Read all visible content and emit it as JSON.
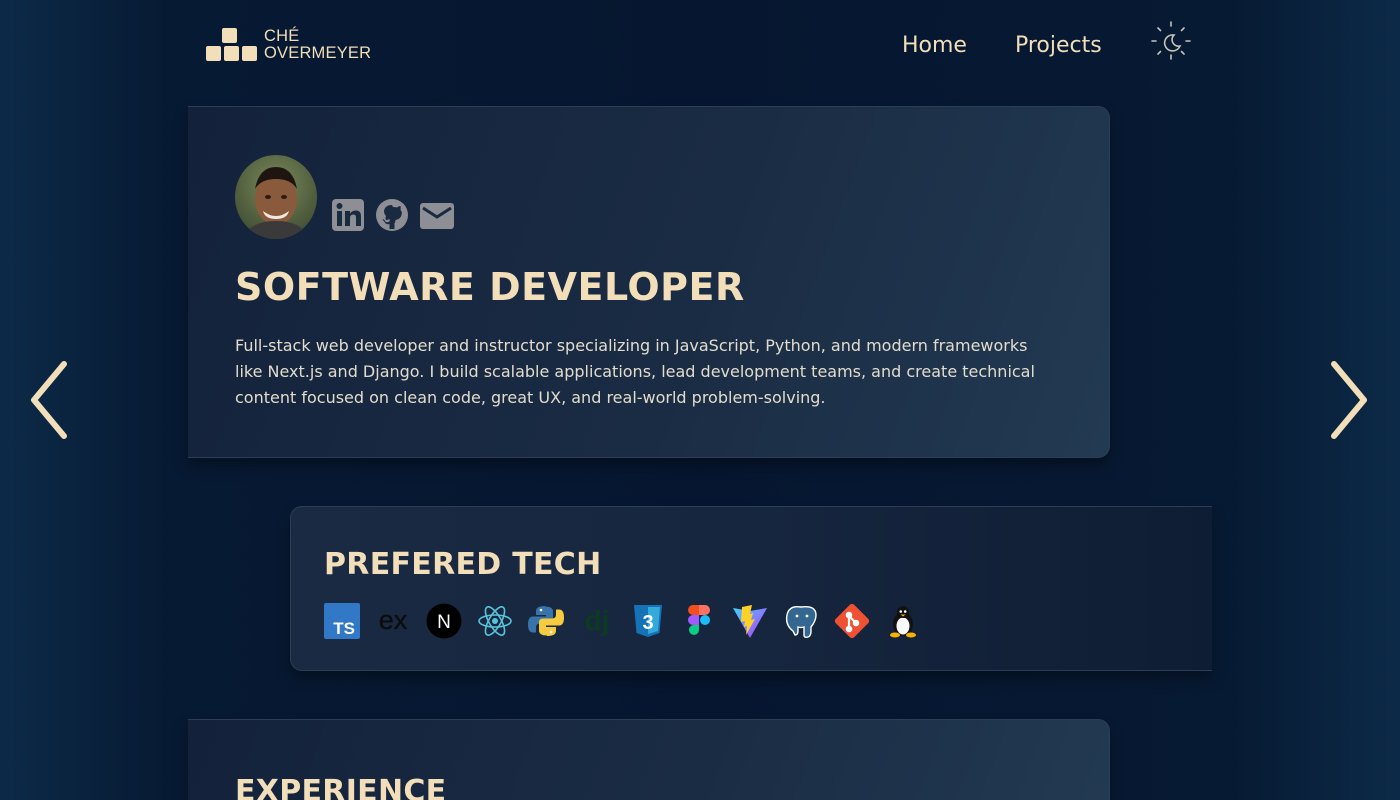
{
  "brand": {
    "line1": "CHÉ",
    "line2": "OVERMEYER"
  },
  "nav": {
    "home": "Home",
    "projects": "Projects"
  },
  "about": {
    "title": "SOFTWARE DEVELOPER",
    "bio": "Full-stack web developer and instructor specializing in JavaScript, Python, and modern frameworks like Next.js and Django. I build scalable applications, lead development teams, and create technical content focused on clean code, great UX, and real-world problem-solving.",
    "social_icons": [
      "linkedin-icon",
      "github-icon",
      "email-icon"
    ]
  },
  "tech": {
    "title": "PREFERED TECH",
    "icons": [
      "typescript-icon",
      "express-icon",
      "nextjs-icon",
      "react-icon",
      "python-icon",
      "django-icon",
      "css3-icon",
      "figma-icon",
      "vite-icon",
      "postgresql-icon",
      "git-icon",
      "linux-icon"
    ],
    "ts_label": "TS",
    "express_label": "ex",
    "next_label": "N",
    "django_label": "dj",
    "css_label": "3"
  },
  "experience": {
    "title": "EXPERIENCE"
  },
  "colors": {
    "accent": "#f2deb8",
    "background": "#061630",
    "card": "#1a2c44"
  }
}
